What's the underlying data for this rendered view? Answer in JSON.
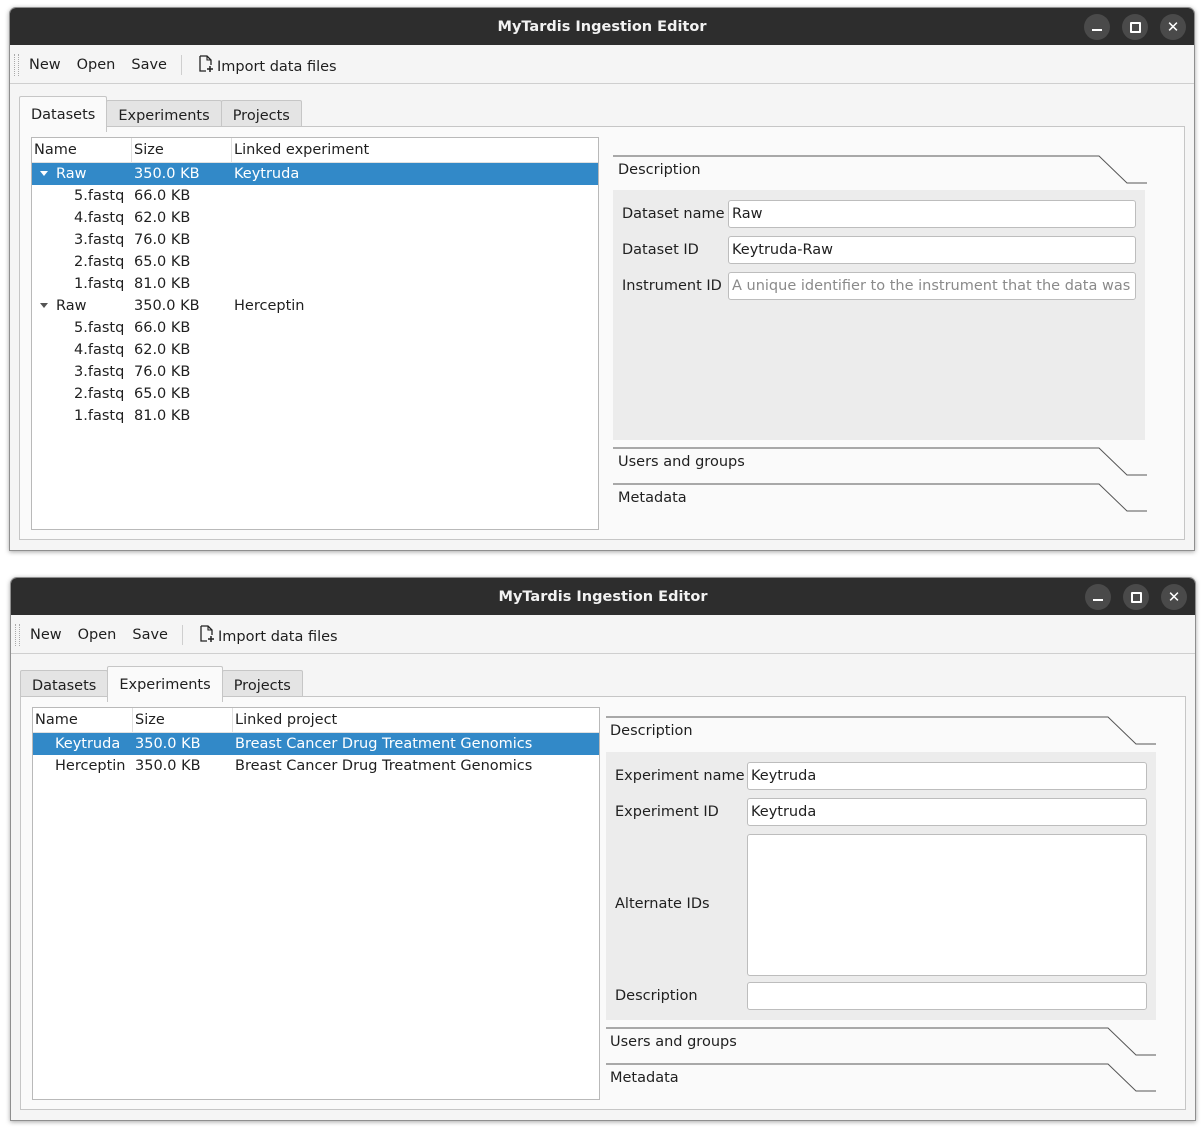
{
  "app_title": "MyTardis Ingestion Editor",
  "toolbar": {
    "new": "New",
    "open": "Open",
    "save": "Save",
    "import": "Import data files"
  },
  "tabs": [
    "Datasets",
    "Experiments",
    "Projects"
  ],
  "window1": {
    "active_tab": "Datasets",
    "columns": [
      "Name",
      "Size",
      "Linked experiment"
    ],
    "rows": [
      {
        "name": "Raw",
        "size": "350.0 KB",
        "linked": "Keytruda",
        "group": true,
        "selected": true
      },
      {
        "name": "5.fastq",
        "size": "66.0 KB",
        "linked": ""
      },
      {
        "name": "4.fastq",
        "size": "62.0 KB",
        "linked": ""
      },
      {
        "name": "3.fastq",
        "size": "76.0 KB",
        "linked": ""
      },
      {
        "name": "2.fastq",
        "size": "65.0 KB",
        "linked": ""
      },
      {
        "name": "1.fastq",
        "size": "81.0 KB",
        "linked": ""
      },
      {
        "name": "Raw",
        "size": "350.0 KB",
        "linked": "Herceptin",
        "group": true
      },
      {
        "name": "5.fastq",
        "size": "66.0 KB",
        "linked": ""
      },
      {
        "name": "4.fastq",
        "size": "62.0 KB",
        "linked": ""
      },
      {
        "name": "3.fastq",
        "size": "76.0 KB",
        "linked": ""
      },
      {
        "name": "2.fastq",
        "size": "65.0 KB",
        "linked": ""
      },
      {
        "name": "1.fastq",
        "size": "81.0 KB",
        "linked": ""
      }
    ],
    "sections": {
      "description": "Description",
      "users": "Users and groups",
      "metadata": "Metadata"
    },
    "form": {
      "dataset_name_label": "Dataset name",
      "dataset_name_value": "Raw",
      "dataset_id_label": "Dataset ID",
      "dataset_id_value": "Keytruda-Raw",
      "instrument_id_label": "Instrument ID",
      "instrument_id_placeholder": "A unique identifier to the instrument that the data was …"
    }
  },
  "window2": {
    "active_tab": "Experiments",
    "columns": [
      "Name",
      "Size",
      "Linked project"
    ],
    "rows": [
      {
        "name": "Keytruda",
        "size": "350.0 KB",
        "linked": "Breast Cancer Drug Treatment Genomics",
        "selected": true
      },
      {
        "name": "Herceptin",
        "size": "350.0 KB",
        "linked": "Breast Cancer Drug Treatment Genomics"
      }
    ],
    "sections": {
      "description": "Description",
      "users": "Users and groups",
      "metadata": "Metadata"
    },
    "form": {
      "experiment_name_label": "Experiment name",
      "experiment_name_value": "Keytruda",
      "experiment_id_label": "Experiment ID",
      "experiment_id_value": "Keytruda",
      "alternate_ids_label": "Alternate IDs",
      "alternate_ids_value": "",
      "description_label": "Description",
      "description_value": ""
    }
  }
}
